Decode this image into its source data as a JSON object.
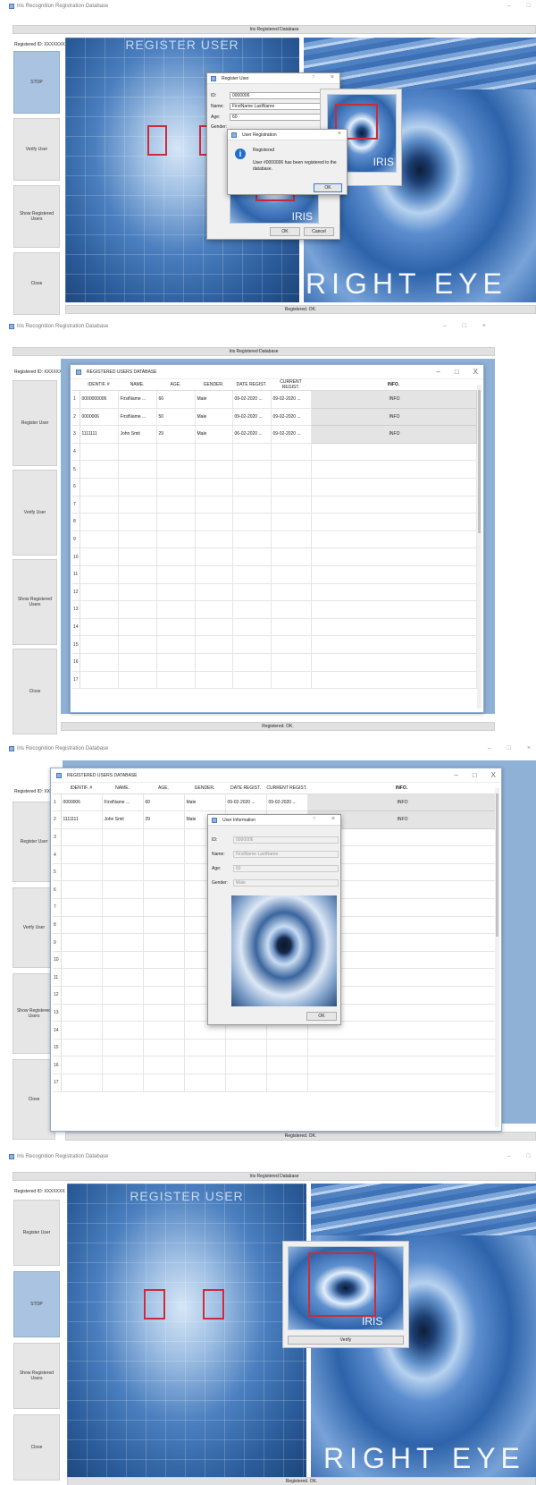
{
  "app": {
    "title": "Iris Recognition Registration Database",
    "database_bar": "Iris Registered Database",
    "registered_id": "Registered ID: XXXXXXX",
    "status": "Registered. OK."
  },
  "sidebar_buttons": {
    "register_user": "Register User",
    "stop": "STOP",
    "verify_user": "Verify User",
    "show_registered_users": "Show Registered Users",
    "close": "Close"
  },
  "face_panel": {
    "title": "REGISTER USER"
  },
  "eye_panel": {
    "title": "RIGHT EYE",
    "iris_label": "IRIS",
    "verify_button": "Verify"
  },
  "register_dialog": {
    "title": "Register User",
    "id_label": "ID:",
    "id_value": "0000006",
    "name_label": "Name:",
    "name_value": "FirstName LastName",
    "age_label": "Age:",
    "age_value": "60",
    "gender_label": "Gender:",
    "ok": "OK",
    "cancel": "Cancel"
  },
  "registration_message": {
    "title": "User Registration",
    "heading": "Registered",
    "body": "User #0000006 has been registered to the database.",
    "ok": "OK"
  },
  "database_window": {
    "title": "REGISTERED USERS DATABASE",
    "columns": [
      "IDENTIF. #",
      "NAME.",
      "AGE.",
      "GENDER.",
      "DATE REGIST.",
      "CURRENT REGIST.",
      "INFO."
    ],
    "rows_screen2": [
      {
        "id": "0000000006",
        "name": "FirstName ...",
        "age": "66",
        "gender": "Male",
        "date": "09-02-2020 ...",
        "current": "09-02-2020 ...",
        "info": "INFO"
      },
      {
        "id": "0000006",
        "name": "FirstName ...",
        "age": "50",
        "gender": "Male",
        "date": "09-02-2020 ...",
        "current": "09-02-2020 ...",
        "info": "INFO"
      },
      {
        "id": "1111111",
        "name": "John Smit",
        "age": "29",
        "gender": "Male",
        "date": "06-02-2020 ...",
        "current": "09-02-2020 ...",
        "info": "INFO"
      }
    ],
    "rows_screen3": [
      {
        "id": "0000006",
        "name": "FirstName ...",
        "age": "60",
        "gender": "Male",
        "date": "09-02-2020 ...",
        "current": "09-02-2020 ...",
        "info": "INFO"
      },
      {
        "id": "1111111",
        "name": "John Smit",
        "age": "29",
        "gender": "Male",
        "date": "",
        "current": "",
        "info": "INFO"
      }
    ],
    "row_count": 17
  },
  "user_info_dialog": {
    "title": "User Information",
    "id_label": "ID:",
    "id_value": "0000006",
    "name_label": "Name:",
    "name_value": "FirstName LastName",
    "age_label": "Age:",
    "age_value": "60",
    "gender_label": "Gender:",
    "gender_value": "Male",
    "ok": "OK"
  },
  "colors": {
    "accent": "#1e6fd0",
    "face_blue": "#4b7fbf",
    "box_red": "#cc2b3a",
    "active_button": "#a9c3e0"
  }
}
